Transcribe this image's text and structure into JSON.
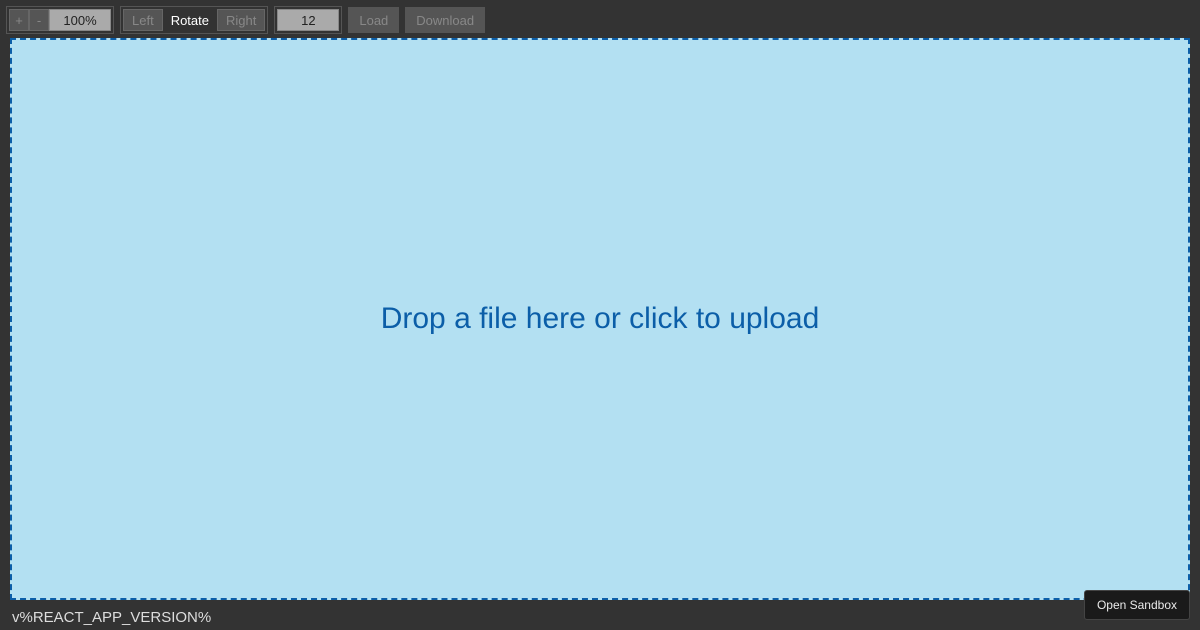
{
  "toolbar": {
    "zoom": {
      "plus_label": "+",
      "minus_label": "-",
      "value": "100%"
    },
    "rotate": {
      "left_label": "Left",
      "rotate_label": "Rotate",
      "right_label": "Right"
    },
    "page_value": "12",
    "load_label": "Load",
    "download_label": "Download"
  },
  "dropzone": {
    "text": "Drop a file here or click to upload"
  },
  "footer": {
    "version_text": "v%REACT_APP_VERSION%"
  },
  "sandbox": {
    "label": "Open Sandbox"
  }
}
